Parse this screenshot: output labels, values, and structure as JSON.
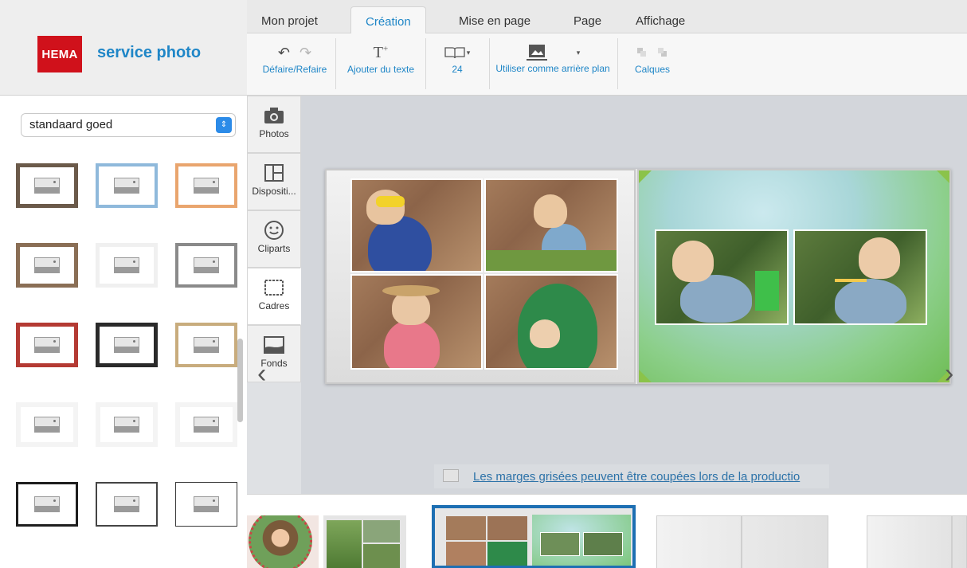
{
  "brand": {
    "logo_text": "HEMA",
    "name": "service photo",
    "logo_color": "#d0111b",
    "accent": "#1f86c7"
  },
  "tabs": [
    {
      "label": "Mon projet",
      "active": false
    },
    {
      "label": "Création",
      "active": true
    },
    {
      "label": "Mise en page",
      "active": false
    },
    {
      "label": "Page",
      "active": false
    },
    {
      "label": "Affichage",
      "active": false
    }
  ],
  "toolbar": {
    "undo_redo": {
      "label": "Défaire/Refaire",
      "icons": [
        "undo-icon",
        "redo-icon"
      ]
    },
    "add_text": {
      "label": "Ajouter du texte",
      "icon": "text-add-icon"
    },
    "pages": {
      "label": "24",
      "icon": "book-icon"
    },
    "background": {
      "label": "Utiliser comme arrière plan",
      "icon": "image-icon"
    },
    "layers": {
      "label": "Calques",
      "icons": [
        "layer-up-icon",
        "layer-down-icon"
      ]
    }
  },
  "left_panel": {
    "style_select": {
      "value": "standaard goed"
    },
    "frames": [
      {
        "color": "#6b5a4a",
        "row": 0
      },
      {
        "color": "#8fb9db",
        "row": 0
      },
      {
        "color": "#e9a56e",
        "row": 0
      },
      {
        "color": "#8a6e55",
        "row": 1
      },
      {
        "color": "#f0f0f0",
        "row": 1
      },
      {
        "color": "#8a8a8a",
        "row": 1
      },
      {
        "color": "#b43a33",
        "row": 2
      },
      {
        "color": "#2a2a2a",
        "row": 2
      },
      {
        "color": "#c8ac7d",
        "row": 2
      },
      {
        "color": "#f4f4f4",
        "row": 3
      },
      {
        "color": "#f4f4f4",
        "row": 3
      },
      {
        "color": "#f4f4f4",
        "row": 3
      },
      {
        "color": "#1e1e1e",
        "row": 4
      },
      {
        "color": "#444444",
        "row": 4
      },
      {
        "color": "#3a3a3a",
        "row": 4
      }
    ]
  },
  "side_tabs": [
    {
      "label": "Photos",
      "icon": "camera-icon",
      "active": false
    },
    {
      "label": "Dispositi...",
      "icon": "layout-icon",
      "active": false
    },
    {
      "label": "Cliparts",
      "icon": "smiley-icon",
      "active": false
    },
    {
      "label": "Cadres",
      "icon": "frame-icon",
      "active": true
    },
    {
      "label": "Fonds",
      "icon": "background-icon",
      "active": false
    }
  ],
  "canvas": {
    "margin_notice": "Les marges grisées peuvent être coupées lors de la productio"
  },
  "filmstrip": {
    "selected_index": 2
  }
}
